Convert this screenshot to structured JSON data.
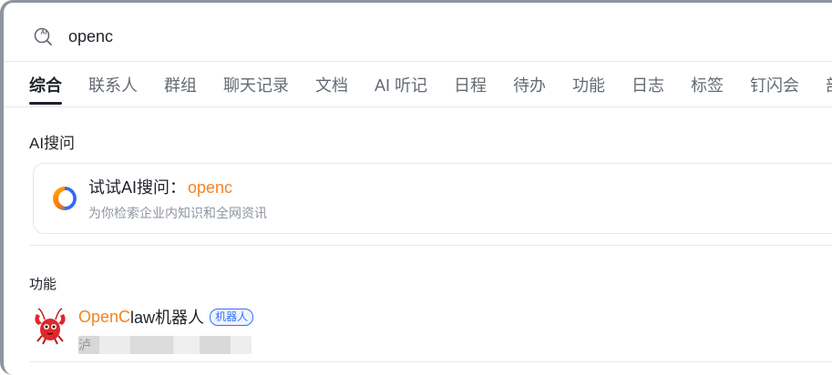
{
  "search": {
    "value": "openc"
  },
  "tabs": [
    {
      "label": "综合",
      "active": true
    },
    {
      "label": "联系人"
    },
    {
      "label": "群组"
    },
    {
      "label": "聊天记录"
    },
    {
      "label": "文档"
    },
    {
      "label": "AI 听记"
    },
    {
      "label": "日程"
    },
    {
      "label": "待办"
    },
    {
      "label": "功能"
    },
    {
      "label": "日志"
    },
    {
      "label": "标签"
    },
    {
      "label": "钉闪会"
    },
    {
      "label": "部"
    }
  ],
  "ai_section": {
    "title": "AI搜问",
    "card_prefix": "试试AI搜问：",
    "card_query": "openc",
    "card_subtitle": "为你检索企业内知识和全网资讯"
  },
  "function_section": {
    "title": "功能",
    "item": {
      "name_highlight": "OpenC",
      "name_rest": "law机器人",
      "badge": "机器人",
      "desc_visible": "泸"
    }
  },
  "colors": {
    "highlight": "#f5821f",
    "badge": "#3370ff"
  },
  "icons": [
    "ai-search-icon",
    "ai-logo-icon",
    "lobster-robot-icon"
  ]
}
